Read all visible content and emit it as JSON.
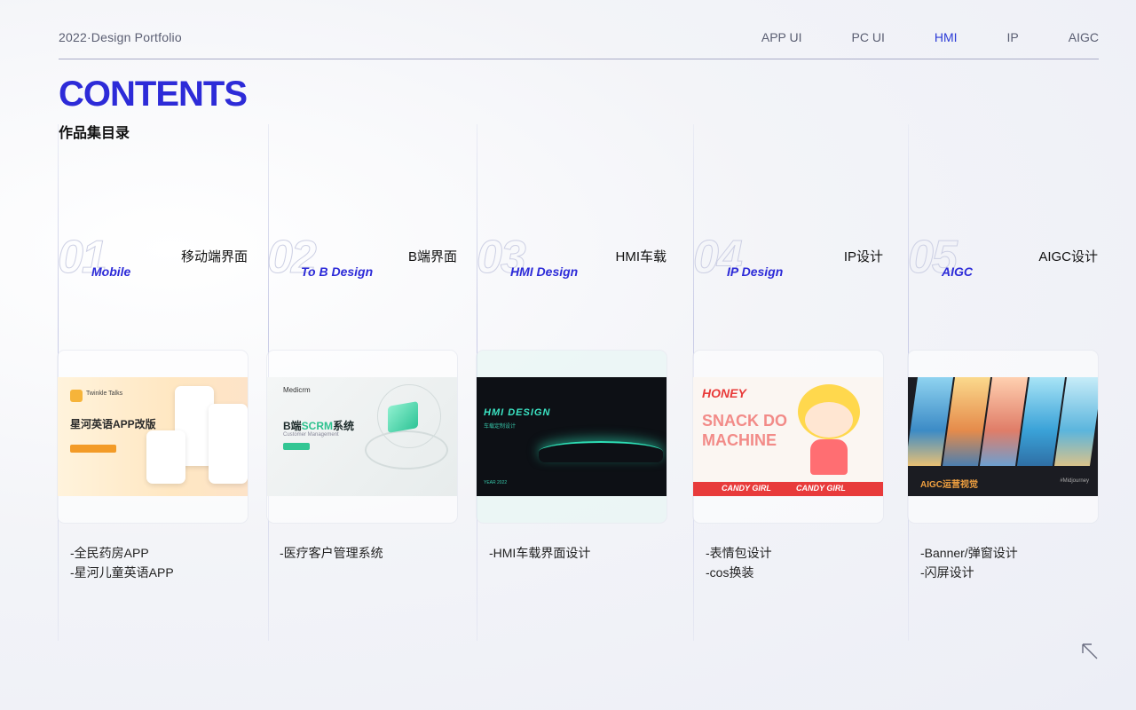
{
  "header": {
    "brand": "2022·Design  Portfolio",
    "nav": [
      "APP UI",
      "PC UI",
      "HMI",
      "IP",
      "AIGC"
    ],
    "active": "HMI"
  },
  "title": "CONTENTS",
  "subtitle": "作品集目录",
  "columns": [
    {
      "num": "01",
      "en": "Mobile",
      "zh": "移动端界面",
      "items": [
        "-全民药房APP",
        "-星河儿童英语APP"
      ],
      "thumb": {
        "logo": "Twinkle Talks",
        "headline": "星河英语APP改版"
      }
    },
    {
      "num": "02",
      "en": "To B Design",
      "zh": "B端界面",
      "items": [
        "-医疗客户管理系统"
      ],
      "thumb": {
        "logo": "Medicrm",
        "headline_a": "B端",
        "headline_b": "SCRM",
        "headline_c": "系统",
        "sub": "Customer Management"
      }
    },
    {
      "num": "03",
      "en": "HMI Design",
      "zh": "HMI车载",
      "items": [
        "-HMI车载界面设计"
      ],
      "thumb": {
        "headline": "HMI DESIGN",
        "sub": "车载定制设计",
        "year": "YEAR 2022"
      }
    },
    {
      "num": "04",
      "en": "IP Design",
      "zh": "IP设计",
      "items": [
        "-表情包设计",
        "-cos换装"
      ],
      "thumb": {
        "brand": "HONEY",
        "line1": "SNACK DO",
        "line2": "MACHINE",
        "band1": "CANDY GIRL",
        "band2": "CANDY GIRL"
      }
    },
    {
      "num": "05",
      "en": "AIGC",
      "zh": "AIGC设计",
      "items": [
        "-Banner/弹窗设计",
        "-闪屏设计"
      ],
      "thumb": {
        "headline": "AIGC运营视觉",
        "tag": "#Midjourney"
      }
    }
  ],
  "colors": {
    "accent": "#2d2bd8",
    "mint": "#32c693",
    "teal": "#3be5c4",
    "red": "#e83b3b"
  },
  "icons": {
    "corner": "arrow-up-left-icon"
  }
}
